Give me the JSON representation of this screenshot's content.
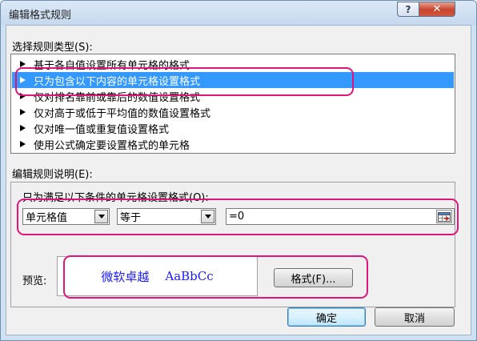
{
  "dialog": {
    "title": "编辑格式规则"
  },
  "rule_type": {
    "label": "选择规则类型(S):",
    "items": [
      {
        "label": "基于各自值设置所有单元格的格式",
        "selected": false
      },
      {
        "label": "只为包含以下内容的单元格设置格式",
        "selected": true
      },
      {
        "label": "仅对排名靠前或靠后的数值设置格式",
        "selected": false
      },
      {
        "label": "仅对高于或低于平均值的数值设置格式",
        "selected": false
      },
      {
        "label": "仅对唯一值或重复值设置格式",
        "selected": false
      },
      {
        "label": "使用公式确定要设置格式的单元格",
        "selected": false
      }
    ]
  },
  "rule_desc": {
    "label": "编辑规则说明(E):",
    "condition_label": "只为满足以下条件的单元格设置格式(O):",
    "field_select": "单元格值",
    "operator_select": "等于",
    "value": "=0"
  },
  "preview": {
    "label": "预览:",
    "sample_cn": "微软卓越",
    "sample_en": "AaBbCc",
    "format_button": "格式(F)..."
  },
  "buttons": {
    "ok": "确定",
    "cancel": "取消"
  },
  "colors": {
    "highlight": "#e0157a",
    "selection": "#3399ff",
    "preview_text": "#1a1aff",
    "close_button": "#c7432d"
  }
}
